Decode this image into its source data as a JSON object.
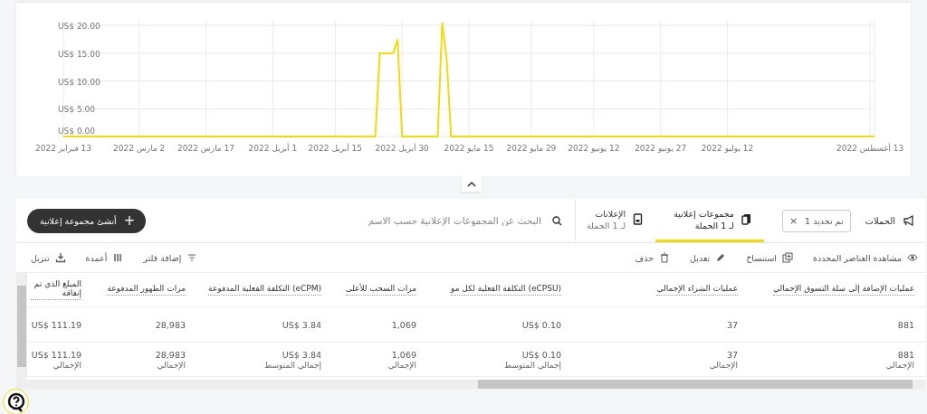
{
  "chart": {
    "y_labels": [
      "US$ 20.00",
      "US$ 15.00",
      "US$ 10.00",
      "US$ 5.00",
      "US$ 0.00"
    ],
    "x_labels": [
      "13 أغسطس 2022",
      "12 يوليو 2022",
      "27 يونيو 2022",
      "12 يونيو 2022",
      "29 مايو 2022",
      "15 مايو 2022",
      "30 أبريل 2022",
      "15 أبريل 2022",
      "1 أبريل 2022",
      "17 مارس 2022",
      "2 مارس 2022",
      "13 فبراير 2022"
    ]
  },
  "breadcrumb": {
    "label": "الحملات",
    "chip": "تم تحديد 1",
    "chip_close": "×"
  },
  "tabs": [
    {
      "label": "مجموعات إعلانية",
      "sub": "لـ 1 الحملة",
      "selected": true
    },
    {
      "label": "الإعلانات",
      "sub": "لـ 1 الحملة",
      "selected": false
    }
  ],
  "search": {
    "placeholder": "البحث عن المجموعات الإعلانية حسب الاسم"
  },
  "create_button": {
    "label": "أنشئ مجموعة إعلانية",
    "icon": "+"
  },
  "actions": [
    {
      "kind": "view",
      "label": "مشاهدة العناصر المحددة"
    },
    {
      "kind": "copy",
      "label": "استنساخ"
    },
    {
      "kind": "edit",
      "label": "تعديل"
    },
    {
      "kind": "delete",
      "label": "حذف"
    }
  ],
  "tools": [
    {
      "kind": "filter",
      "label": "إضافة فلتر"
    },
    {
      "kind": "columns",
      "label": "أعمدة"
    },
    {
      "kind": "download",
      "label": "تنزيل"
    }
  ],
  "table": {
    "columns": [
      {
        "label": "عمليات الإضافة إلى سلة التسوق الإجمالي"
      },
      {
        "label": "عمليات الشراء الإجمالي"
      },
      {
        "label": "(eCPSU) التكلفة الفعلية لكل مو"
      },
      {
        "label": "مرات السحب للأعلى"
      },
      {
        "label": "(eCPM) التكلفة الفعلية المدفوعة"
      },
      {
        "label": "مرات الظهور المدفوعة"
      },
      {
        "label": "المبلغ الذي تم إنفاقه"
      }
    ],
    "rows": [
      {
        "cells": [
          "881",
          "37",
          "US$ 0.10",
          "1,069",
          "US$ 3.84",
          "28,983",
          "US$ 111.19"
        ]
      }
    ],
    "totals": [
      {
        "value": "881",
        "caption": "الإجمالي"
      },
      {
        "value": "37",
        "caption": "الإجمالي"
      },
      {
        "value": "US$ 0.10",
        "caption": "إجمالي المتوسط"
      },
      {
        "value": "1,069",
        "caption": "الإجمالي"
      },
      {
        "value": "US$ 3.84",
        "caption": "إجمالي المتوسط"
      },
      {
        "value": "28,983",
        "caption": "الإجمالي"
      },
      {
        "value": "US$ 111.19",
        "caption": "الإجمالي"
      }
    ]
  }
}
